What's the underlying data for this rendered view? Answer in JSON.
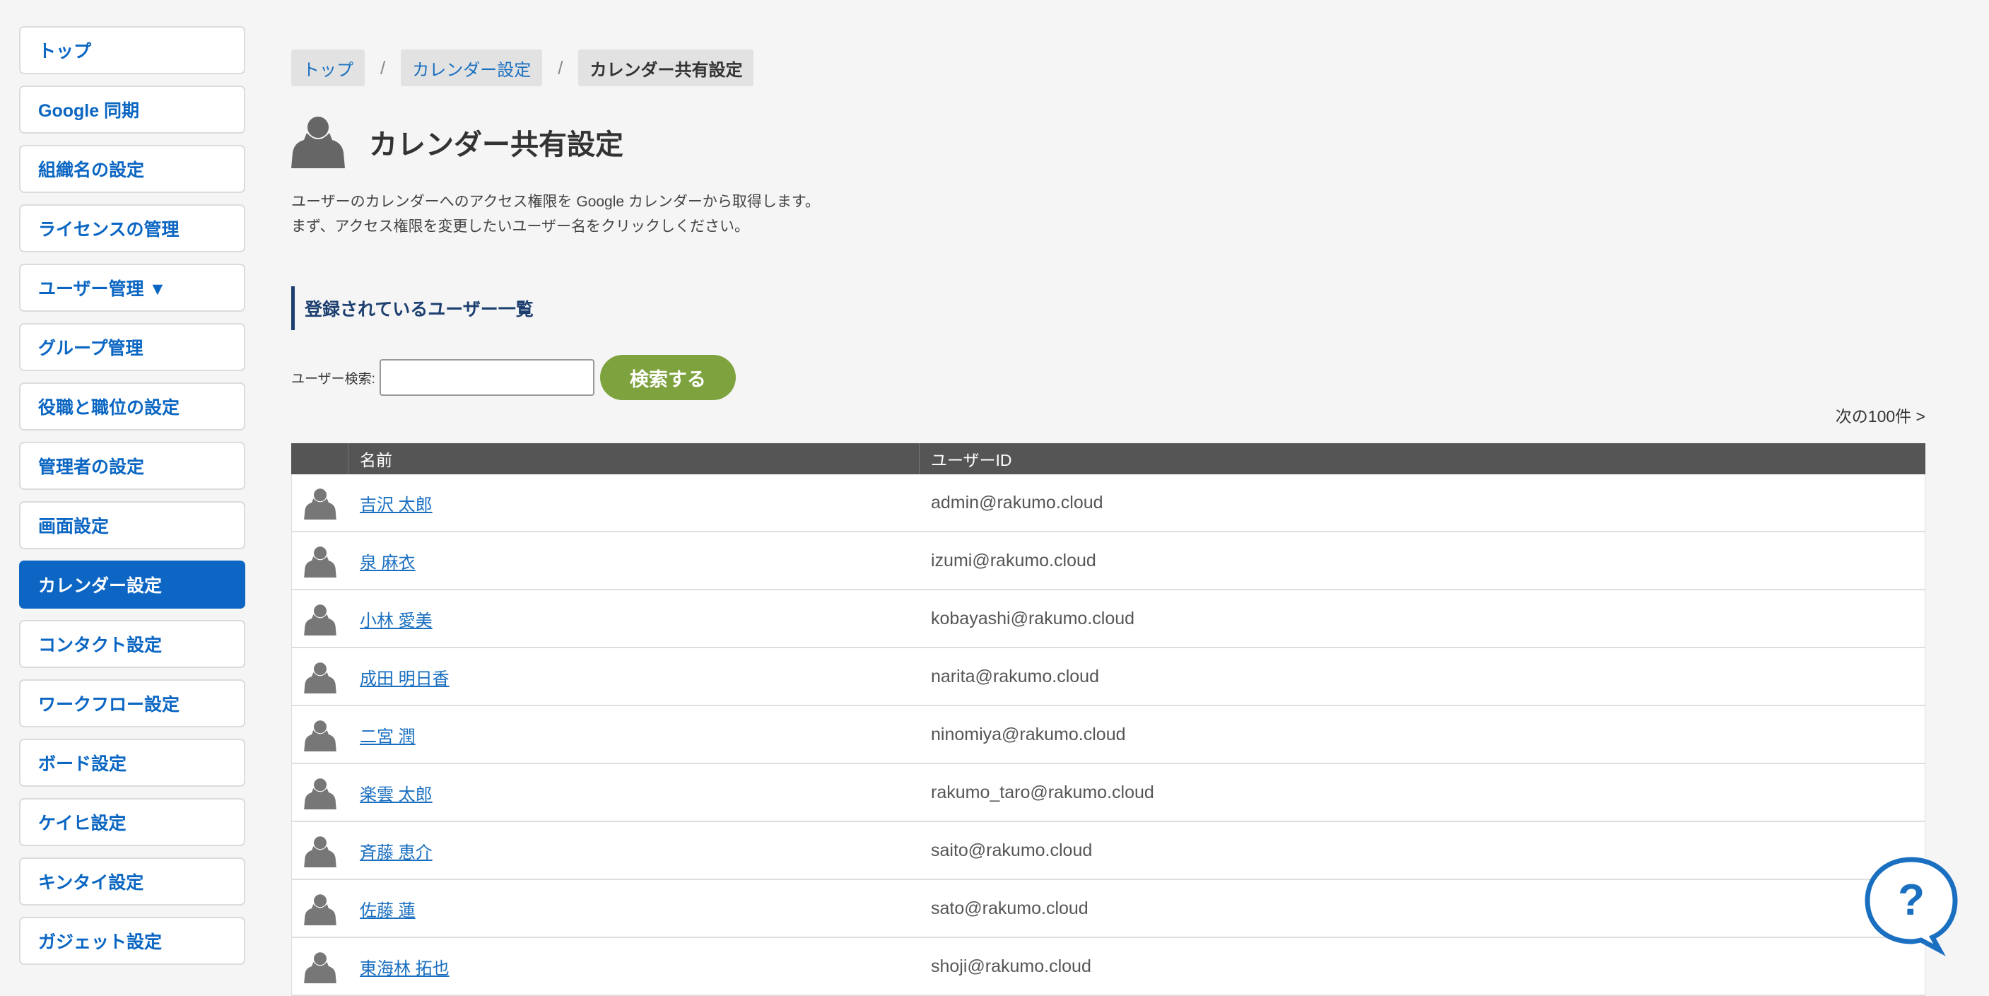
{
  "sidebar": {
    "items": [
      {
        "label": "トップ"
      },
      {
        "label": "Google 同期"
      },
      {
        "label": "組織名の設定"
      },
      {
        "label": "ライセンスの管理"
      },
      {
        "label": "ユーザー管理 ▼"
      },
      {
        "label": "グループ管理"
      },
      {
        "label": "役職と職位の設定"
      },
      {
        "label": "管理者の設定"
      },
      {
        "label": "画面設定"
      },
      {
        "label": "カレンダー設定",
        "active": true
      },
      {
        "label": "コンタクト設定"
      },
      {
        "label": "ワークフロー設定"
      },
      {
        "label": "ボード設定"
      },
      {
        "label": "ケイヒ設定"
      },
      {
        "label": "キンタイ設定"
      },
      {
        "label": "ガジェット設定"
      }
    ]
  },
  "breadcrumb": {
    "items": [
      "トップ",
      "カレンダー設定",
      "カレンダー共有設定"
    ],
    "separator": "/"
  },
  "page": {
    "title": "カレンダー共有設定",
    "desc_line1": "ユーザーのカレンダーへのアクセス権限を Google カレンダーから取得します。",
    "desc_line2": "まず、アクセス権限を変更したいユーザー名をクリックしください。",
    "section_title": "登録されているユーザー一覧"
  },
  "search": {
    "label": "ユーザー検索:",
    "value": "",
    "button_label": "検索する"
  },
  "pagination": {
    "next_label": "次の100件 >"
  },
  "table": {
    "headers": [
      "",
      "名前",
      "ユーザーID"
    ],
    "rows": [
      {
        "name": "吉沢 太郎",
        "id": "admin@rakumo.cloud"
      },
      {
        "name": "泉 麻衣",
        "id": "izumi@rakumo.cloud"
      },
      {
        "name": "小林 愛美",
        "id": "kobayashi@rakumo.cloud"
      },
      {
        "name": "成田 明日香",
        "id": "narita@rakumo.cloud"
      },
      {
        "name": "二宮 潤",
        "id": "ninomiya@rakumo.cloud"
      },
      {
        "name": "楽雲 太郎",
        "id": "rakumo_taro@rakumo.cloud"
      },
      {
        "name": "斉藤 恵介",
        "id": "saito@rakumo.cloud"
      },
      {
        "name": "佐藤 蓮",
        "id": "sato@rakumo.cloud"
      },
      {
        "name": "東海林 拓也",
        "id": "shoji@rakumo.cloud"
      }
    ]
  },
  "icons": {
    "user_avatar": "user-silhouette-icon",
    "help": "help-question-icon"
  },
  "colors": {
    "accent_blue": "#0d66c4",
    "link_blue": "#1a6fc0",
    "search_button_green": "#7ea23e",
    "table_header": "#555555",
    "section_border": "#1c3f70"
  }
}
